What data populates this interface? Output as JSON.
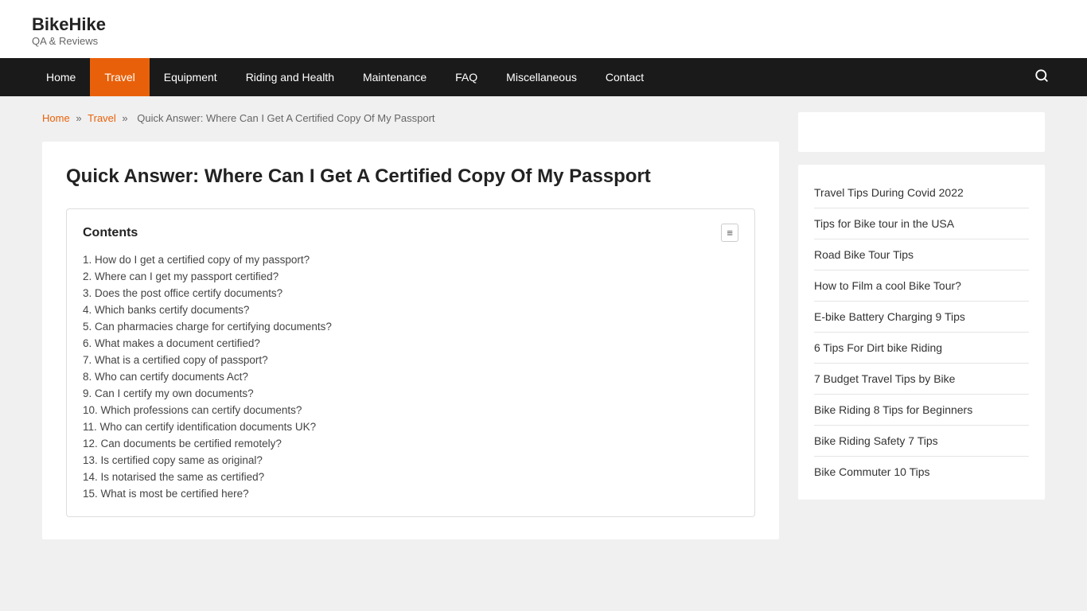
{
  "site": {
    "title": "BikeHike",
    "tagline": "QA & Reviews"
  },
  "nav": {
    "items": [
      {
        "label": "Home",
        "active": false
      },
      {
        "label": "Travel",
        "active": true
      },
      {
        "label": "Equipment",
        "active": false
      },
      {
        "label": "Riding and Health",
        "active": false
      },
      {
        "label": "Maintenance",
        "active": false
      },
      {
        "label": "FAQ",
        "active": false
      },
      {
        "label": "Miscellaneous",
        "active": false
      },
      {
        "label": "Contact",
        "active": false
      }
    ]
  },
  "breadcrumb": {
    "home": "Home",
    "travel": "Travel",
    "current": "Quick Answer: Where Can I Get A Certified Copy Of My Passport"
  },
  "article": {
    "title": "Quick Answer: Where Can I Get A Certified Copy Of My Passport",
    "toc": {
      "heading": "Contents",
      "toggle_label": "≡",
      "items": [
        {
          "num": "1",
          "text": "How do I get a certified copy of my passport?"
        },
        {
          "num": "2",
          "text": "Where can I get my passport certified?"
        },
        {
          "num": "3",
          "text": "Does the post office certify documents?"
        },
        {
          "num": "4",
          "text": "Which banks certify documents?"
        },
        {
          "num": "5",
          "text": "Can pharmacies charge for certifying documents?"
        },
        {
          "num": "6",
          "text": "What makes a document certified?"
        },
        {
          "num": "7",
          "text": "What is a certified copy of passport?"
        },
        {
          "num": "8",
          "text": "Who can certify documents Act?"
        },
        {
          "num": "9",
          "text": "Can I certify my own documents?"
        },
        {
          "num": "10",
          "text": "Which professions can certify documents?"
        },
        {
          "num": "11",
          "text": "Who can certify identification documents UK?"
        },
        {
          "num": "12",
          "text": "Can documents be certified remotely?"
        },
        {
          "num": "13",
          "text": "Is certified copy same as original?"
        },
        {
          "num": "14",
          "text": "Is notarised the same as certified?"
        },
        {
          "num": "15",
          "text": "What is most be certified here?"
        }
      ]
    }
  },
  "sidebar": {
    "links": [
      {
        "text": "Travel Tips During Covid 2022"
      },
      {
        "text": "Tips for Bike tour in the USA"
      },
      {
        "text": "Road Bike Tour Tips"
      },
      {
        "text": "How to Film a cool Bike Tour?"
      },
      {
        "text": "E-bike Battery Charging 9 Tips"
      },
      {
        "text": "6 Tips For Dirt bike Riding"
      },
      {
        "text": "7 Budget Travel Tips by Bike"
      },
      {
        "text": "Bike Riding 8 Tips for Beginners"
      },
      {
        "text": "Bike Riding Safety 7 Tips"
      },
      {
        "text": "Bike Commuter 10 Tips"
      }
    ]
  }
}
